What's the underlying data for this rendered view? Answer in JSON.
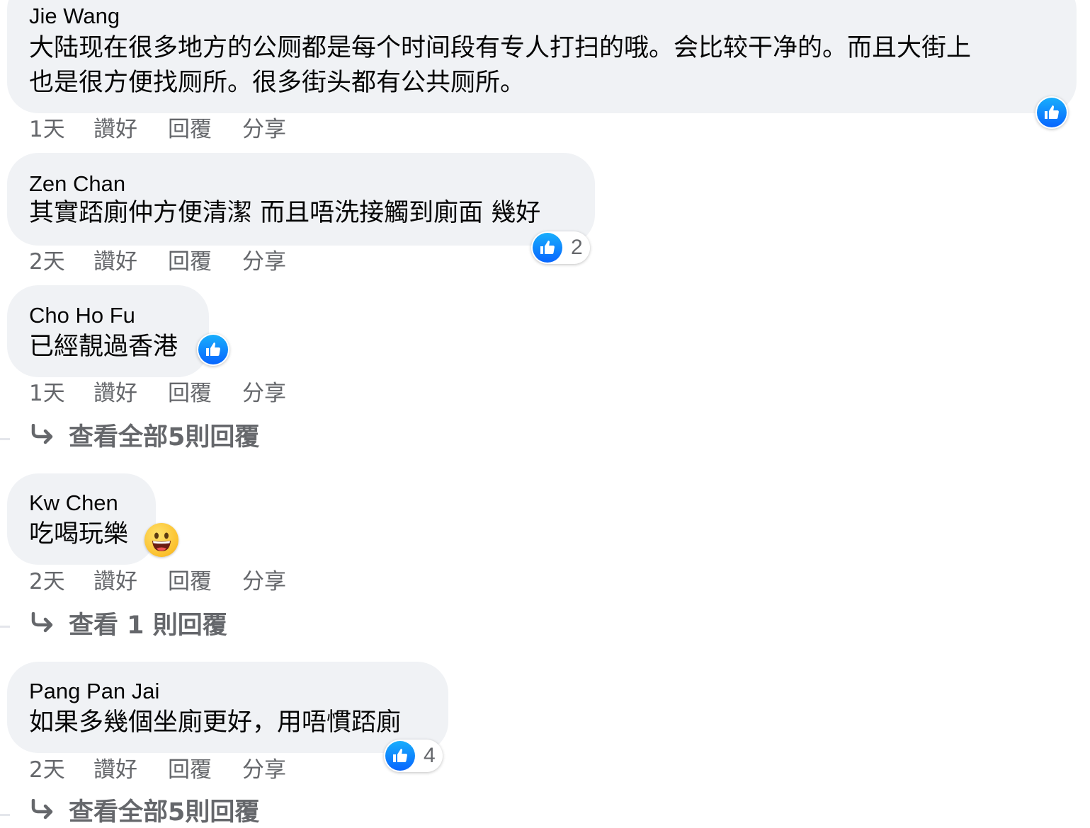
{
  "comments": [
    {
      "author": "Jie Wang",
      "text_line1": "大陆现在很多地方的公厕都是每个时间段有专人打扫的哦。会比较干净的。而且大街上",
      "text_line2": "也是很方便找厕所。很多街头都有公共厕所。",
      "time": "1天",
      "like": "讚好",
      "reply": "回覆",
      "share": "分享"
    },
    {
      "author": "Zen Chan",
      "text": "其實踎廁仲方便清潔 而且唔洗接觸到廁面 幾好",
      "reaction_count": "2",
      "time": "2天",
      "like": "讚好",
      "reply": "回覆",
      "share": "分享"
    },
    {
      "author": "Cho Ho Fu",
      "text": "已經靚過香港",
      "time": "1天",
      "like": "讚好",
      "reply": "回覆",
      "share": "分享",
      "view_replies": "查看全部5則回覆"
    },
    {
      "author": "Kw Chen",
      "text": "吃喝玩樂",
      "emoji": "grinning-face-emoji",
      "time": "2天",
      "like": "讚好",
      "reply": "回覆",
      "share": "分享",
      "view_replies": "查看 1 則回覆"
    },
    {
      "author": "Pang Pan Jai",
      "text": "如果多幾個坐廁更好，用唔慣踎廁",
      "reaction_count": "4",
      "time": "2天",
      "like": "讚好",
      "reply": "回覆",
      "share": "分享",
      "view_replies": "查看全部5則回覆"
    }
  ],
  "icons": {
    "reaction": "thumbs-up-icon",
    "reply_arrow": "reply-arrow-icon"
  },
  "colors": {
    "bubble": "#f0f2f5",
    "secondary_text": "#65676b",
    "like_blue": "#0866ff"
  }
}
